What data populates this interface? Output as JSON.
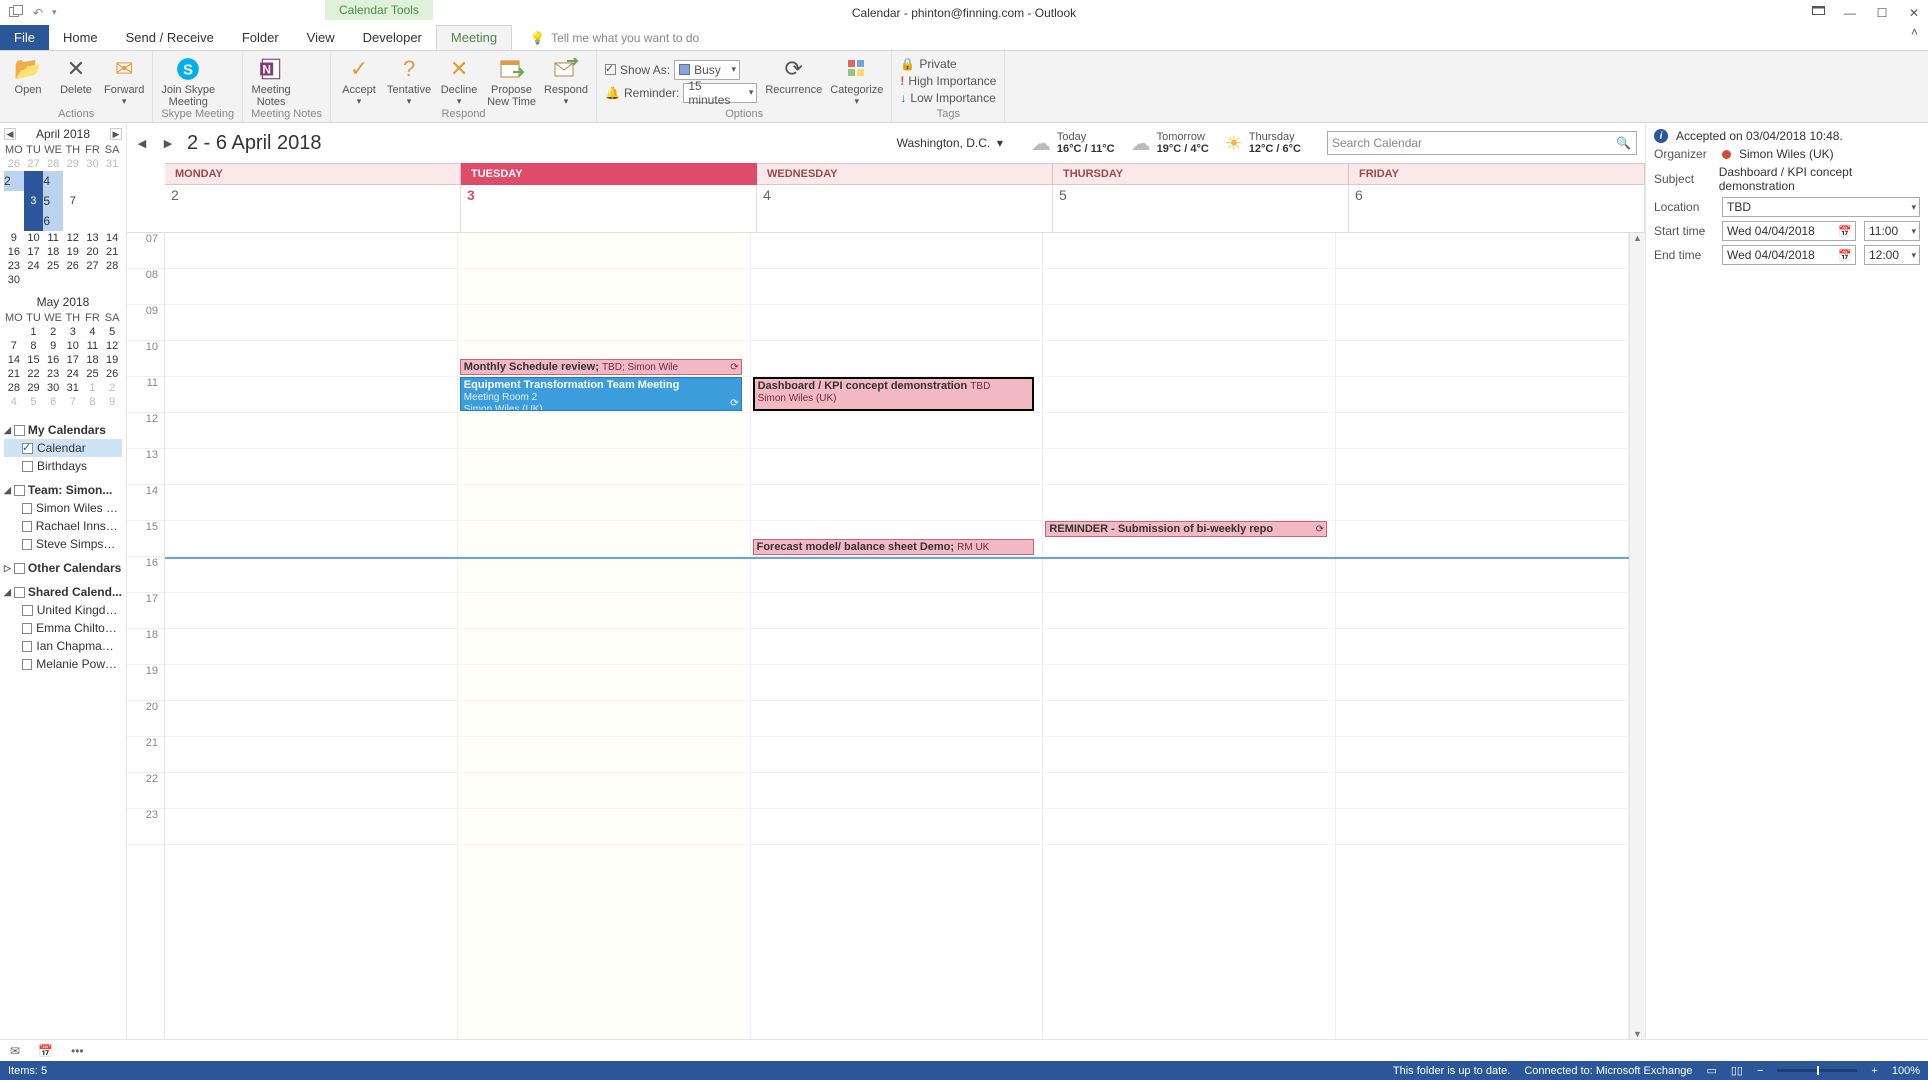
{
  "title": "Calendar - phinton@finning.com  -  Outlook",
  "context_tab": "Calendar Tools",
  "tabs": {
    "file": "File",
    "home": "Home",
    "sr": "Send / Receive",
    "folder": "Folder",
    "view": "View",
    "dev": "Developer",
    "meeting": "Meeting",
    "tellme": "Tell me what you want to do"
  },
  "ribbon": {
    "actions": {
      "open": "Open",
      "delete": "Delete",
      "forward": "Forward",
      "group": "Actions"
    },
    "skype": {
      "btn": "Join Skype\nMeeting",
      "group": "Skype Meeting"
    },
    "notes": {
      "btn": "Meeting\nNotes",
      "group": "Meeting Notes"
    },
    "respond": {
      "accept": "Accept",
      "tentative": "Tentative",
      "decline": "Decline",
      "propose": "Propose\nNew Time",
      "respond": "Respond",
      "group": "Respond"
    },
    "options": {
      "showas_lbl": "Show As:",
      "showas_val": "Busy",
      "reminder_lbl": "Reminder:",
      "reminder_val": "15 minutes",
      "recurrence": "Recurrence",
      "categorize": "Categorize",
      "group": "Options"
    },
    "tags": {
      "private": "Private",
      "high": "High Importance",
      "low": "Low Importance",
      "group": "Tags"
    }
  },
  "mini_months": [
    {
      "title": "April 2018",
      "dows": [
        "MO",
        "TU",
        "WE",
        "TH",
        "FR",
        "SA"
      ],
      "weeks": [
        [
          {
            "n": 26,
            "dim": true
          },
          {
            "n": 27,
            "dim": true
          },
          {
            "n": 28,
            "dim": true
          },
          {
            "n": 29,
            "dim": true
          },
          {
            "n": 30,
            "dim": true
          },
          {
            "n": 31,
            "dim": true
          }
        ],
        [
          {
            "n": 2,
            "sel": true
          },
          {
            "n": 3,
            "cur": true
          },
          {
            "n": 4,
            "sel": true
          },
          {
            "n": 5,
            "sel": true
          },
          {
            "n": 6,
            "sel": true
          },
          {
            "n": 7
          }
        ],
        [
          {
            "n": 9
          },
          {
            "n": 10
          },
          {
            "n": 11
          },
          {
            "n": 12
          },
          {
            "n": 13
          },
          {
            "n": 14
          }
        ],
        [
          {
            "n": 16
          },
          {
            "n": 17
          },
          {
            "n": 18
          },
          {
            "n": 19
          },
          {
            "n": 20
          },
          {
            "n": 21
          }
        ],
        [
          {
            "n": 23
          },
          {
            "n": 24
          },
          {
            "n": 25
          },
          {
            "n": 26
          },
          {
            "n": 27
          },
          {
            "n": 28
          }
        ],
        [
          {
            "n": 30
          },
          {
            "n": "",
            "dim": true
          },
          {
            "n": "",
            "dim": true
          },
          {
            "n": "",
            "dim": true
          },
          {
            "n": "",
            "dim": true
          },
          {
            "n": "",
            "dim": true
          }
        ]
      ]
    },
    {
      "title": "May 2018",
      "dows": [
        "MO",
        "TU",
        "WE",
        "TH",
        "FR",
        "SA"
      ],
      "weeks": [
        [
          {
            "n": "",
            "dim": true
          },
          {
            "n": 1
          },
          {
            "n": 2
          },
          {
            "n": 3
          },
          {
            "n": 4
          },
          {
            "n": 5
          }
        ],
        [
          {
            "n": 7
          },
          {
            "n": 8
          },
          {
            "n": 9
          },
          {
            "n": 10
          },
          {
            "n": 11
          },
          {
            "n": 12
          }
        ],
        [
          {
            "n": 14
          },
          {
            "n": 15
          },
          {
            "n": 16
          },
          {
            "n": 17
          },
          {
            "n": 18
          },
          {
            "n": 19
          }
        ],
        [
          {
            "n": 21
          },
          {
            "n": 22
          },
          {
            "n": 23
          },
          {
            "n": 24
          },
          {
            "n": 25
          },
          {
            "n": 26
          }
        ],
        [
          {
            "n": 28
          },
          {
            "n": 29
          },
          {
            "n": 30
          },
          {
            "n": 31
          },
          {
            "n": 1,
            "dim": true
          },
          {
            "n": 2,
            "dim": true
          }
        ],
        [
          {
            "n": 4,
            "dim": true
          },
          {
            "n": 5,
            "dim": true
          },
          {
            "n": 6,
            "dim": true
          },
          {
            "n": 7,
            "dim": true
          },
          {
            "n": 8,
            "dim": true
          },
          {
            "n": 9,
            "dim": true
          }
        ]
      ]
    }
  ],
  "cal_groups": [
    {
      "name": "My Calendars",
      "items": [
        {
          "label": "Calendar",
          "checked": true,
          "selected": true
        },
        {
          "label": "Birthdays",
          "checked": false
        }
      ]
    },
    {
      "name": "Team: Simon...",
      "items": [
        {
          "label": "Simon Wiles (UK)",
          "checked": false
        },
        {
          "label": "Rachael Inns (UK)",
          "checked": false
        },
        {
          "label": "Steve Simpson ...",
          "checked": false
        }
      ]
    },
    {
      "name": "Other Calendars",
      "items": [],
      "collapsed": true
    },
    {
      "name": "Shared Calend...",
      "items": [
        {
          "label": "United Kingdo...",
          "checked": false
        },
        {
          "label": "Emma Chilton (...",
          "checked": false
        },
        {
          "label": "Ian Chapman (...",
          "checked": false
        },
        {
          "label": "Melanie Powell...",
          "checked": false
        }
      ]
    }
  ],
  "main": {
    "range": "2 - 6 April 2018",
    "location": "Washington, D.C.",
    "weather": [
      {
        "lbl": "Today",
        "temp": "16°C / 11°C",
        "icon": "cloud"
      },
      {
        "lbl": "Tomorrow",
        "temp": "19°C / 4°C",
        "icon": "cloud"
      },
      {
        "lbl": "Thursday",
        "temp": "12°C / 6°C",
        "icon": "sun"
      }
    ],
    "search_placeholder": "Search Calendar",
    "days": [
      {
        "dow": "MONDAY",
        "date": "2",
        "today": false
      },
      {
        "dow": "TUESDAY",
        "date": "3",
        "today": true
      },
      {
        "dow": "WEDNESDAY",
        "date": "4",
        "today": false
      },
      {
        "dow": "THURSDAY",
        "date": "5",
        "today": false
      },
      {
        "dow": "FRIDAY",
        "date": "6",
        "today": false
      }
    ],
    "hours": [
      "07",
      "08",
      "09",
      "10",
      "11",
      "12",
      "13",
      "14",
      "15",
      "16",
      "17",
      "18",
      "19",
      "20",
      "21",
      "22",
      "23"
    ],
    "events": [
      {
        "day": 1,
        "start": 10.5,
        "dur": 0.5,
        "title": "Monthly Schedule review;",
        "sub": "TBD; Simon Wile",
        "cls": "",
        "rec": true
      },
      {
        "day": 1,
        "start": 11,
        "dur": 1,
        "title": "Equipment Transformation Team Meeting",
        "sub": "Meeting Room 2",
        "sub2": "Simon Wiles (UK)",
        "cls": "blue",
        "rec": true
      },
      {
        "day": 2,
        "start": 11,
        "dur": 1,
        "title": "Dashboard / KPI concept demonstration",
        "sub": "TBD",
        "sub2": "Simon Wiles (UK)",
        "cls": "selected"
      },
      {
        "day": 2,
        "start": 15.5,
        "dur": 0.5,
        "title": "Forecast model/ balance sheet Demo;",
        "sub": "RM UK",
        "cls": ""
      },
      {
        "day": 3,
        "start": 15,
        "dur": 0.5,
        "title": "REMINDER - Submission of bi-weekly repo",
        "cls": "",
        "rec": true
      }
    ],
    "now_hour": 16
  },
  "inspector": {
    "accepted": "Accepted on 03/04/2018 10:48.",
    "organizer_lbl": "Organizer",
    "organizer": "Simon Wiles (UK)",
    "subject_lbl": "Subject",
    "subject": "Dashboard / KPI concept demonstration",
    "location_lbl": "Location",
    "location": "TBD",
    "start_lbl": "Start time",
    "start_date": "Wed 04/04/2018",
    "start_time": "11:00",
    "end_lbl": "End time",
    "end_date": "Wed 04/04/2018",
    "end_time": "12:00"
  },
  "status": {
    "items": "Items: 5",
    "uptodate": "This folder is up to date.",
    "connected": "Connected to: Microsoft Exchange",
    "zoom": "100%"
  }
}
